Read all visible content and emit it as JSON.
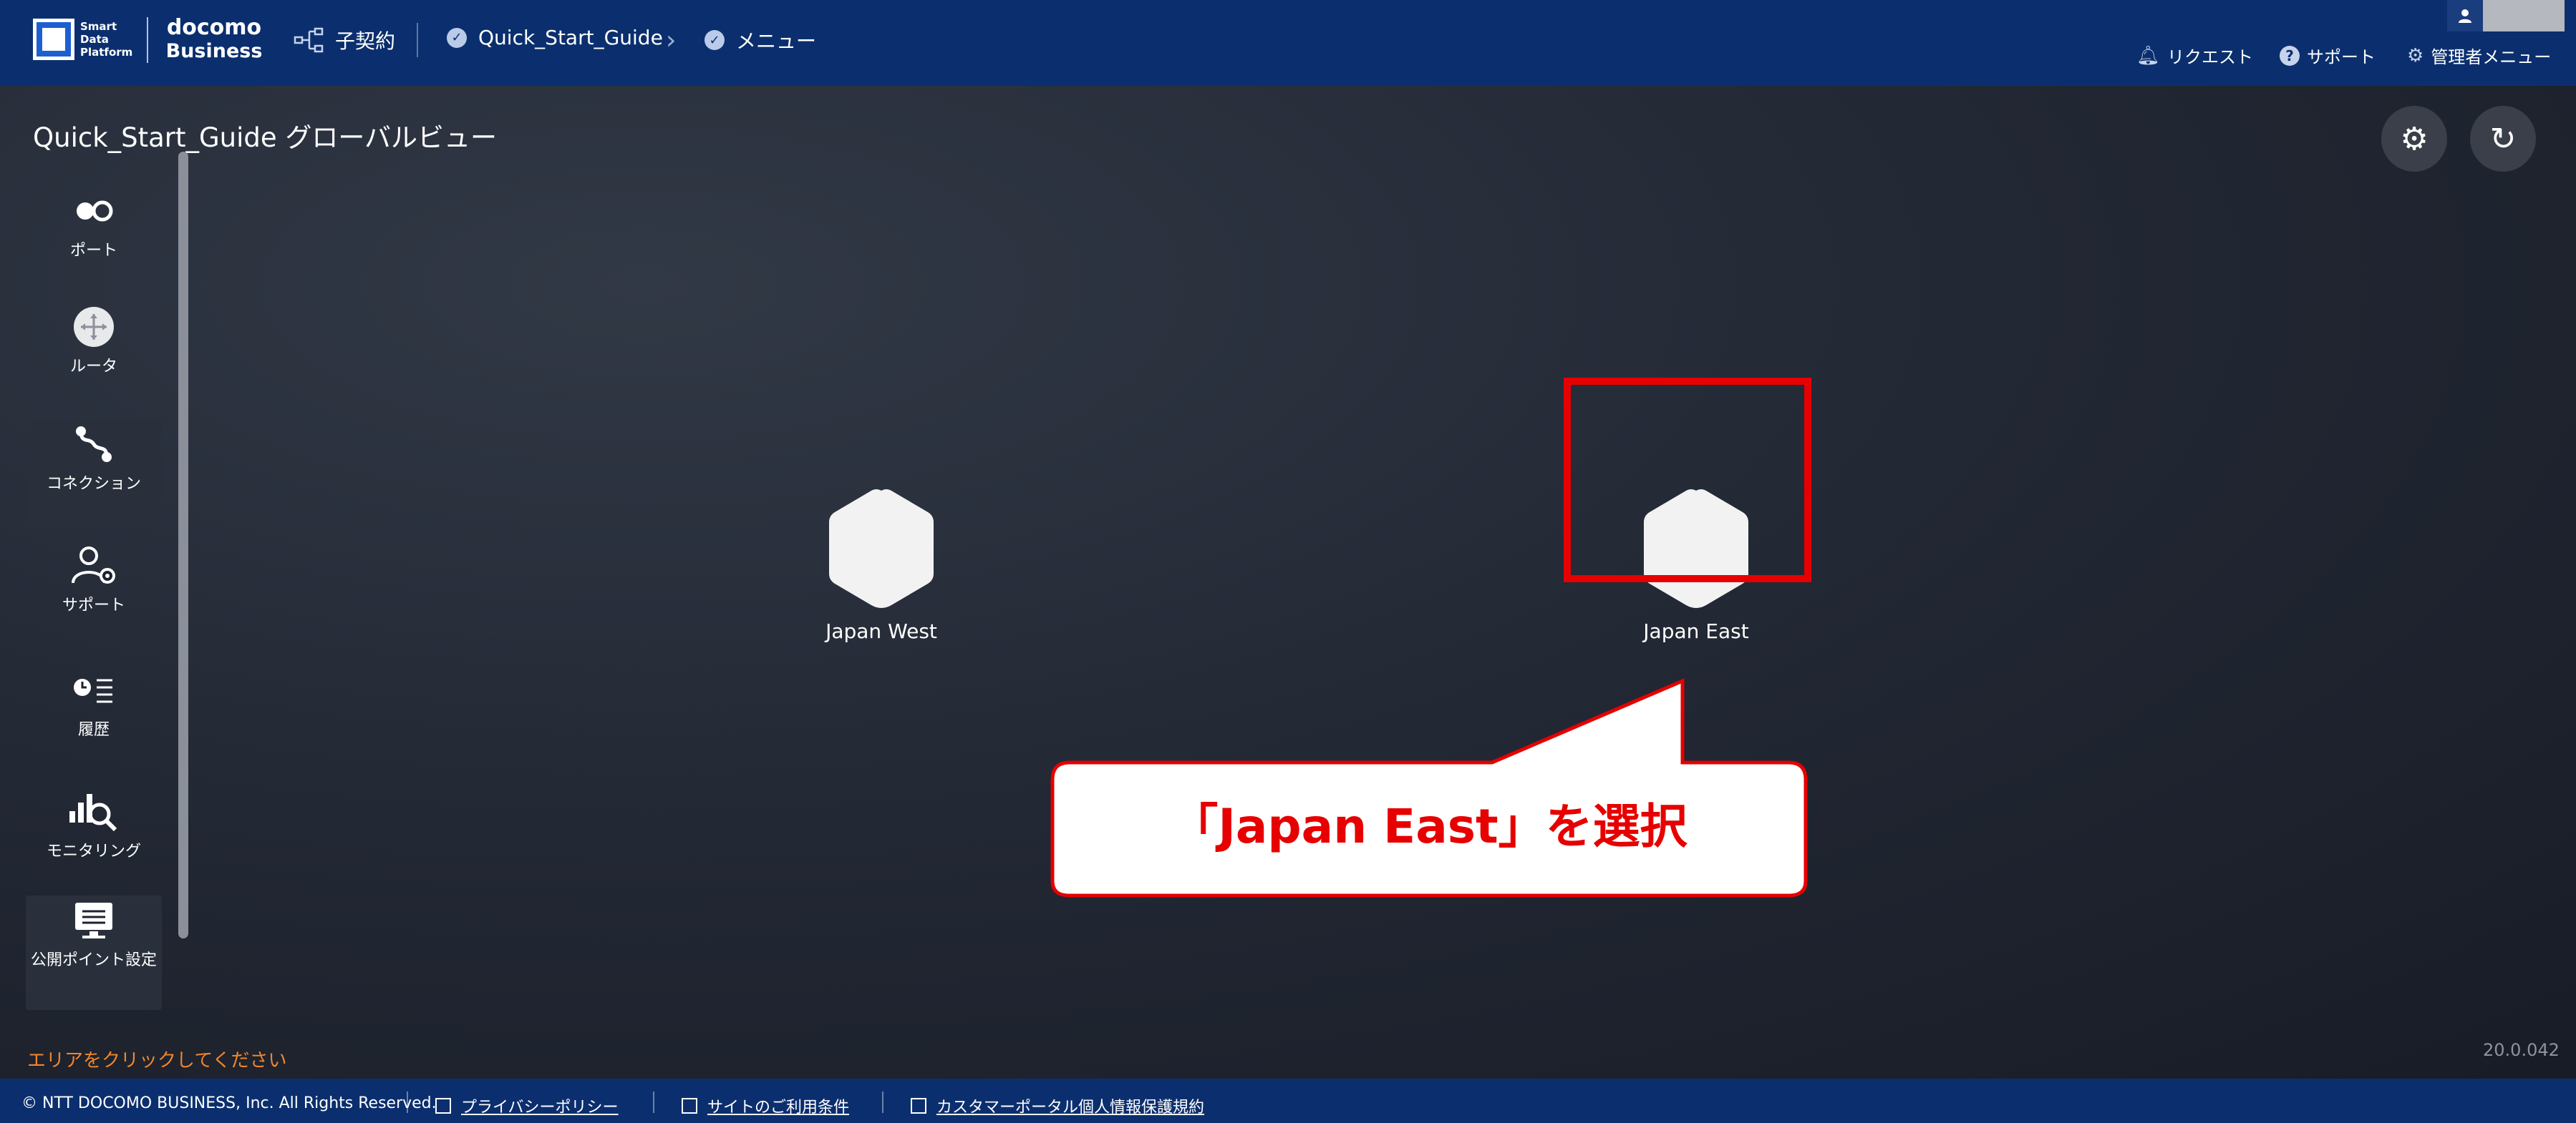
{
  "header": {
    "logo_sdp_line1": "Smart",
    "logo_sdp_line2": "Data",
    "logo_sdp_line3": "Platform",
    "logo_docomo_line1": "docomo",
    "logo_docomo_line2": "Business",
    "breadcrumb": {
      "contract": "子契約",
      "guide": "Quick_Start_Guide",
      "menu": "メニュー"
    },
    "actions": {
      "request": "リクエスト",
      "support": "サポート",
      "admin_menu": "管理者メニュー"
    }
  },
  "main": {
    "title": "Quick_Start_Guide グローバルビュー",
    "hint": "エリアをクリックしてください",
    "version": "20.0.042"
  },
  "sidebar": {
    "items": [
      {
        "label": "ポート",
        "icon": "port-icon"
      },
      {
        "label": "ルータ",
        "icon": "router-icon"
      },
      {
        "label": "コネクション",
        "icon": "connection-icon"
      },
      {
        "label": "サポート",
        "icon": "support-user-icon"
      },
      {
        "label": "履歴",
        "icon": "history-icon"
      },
      {
        "label": "モニタリング",
        "icon": "monitoring-icon"
      },
      {
        "label": "公開ポイント設定",
        "icon": "monitor-icon"
      }
    ]
  },
  "regions": [
    {
      "name": "Japan West"
    },
    {
      "name": "Japan East"
    }
  ],
  "annotation": {
    "callout_text": "「Japan East」を選択",
    "highlight_color": "#e60000"
  },
  "footer": {
    "copyright": "© NTT DOCOMO BUSINESS, Inc. All Rights Reserved.",
    "privacy": "プライバシーポリシー",
    "terms": "サイトのご利用条件",
    "personal_info": "カスタマーポータル個人情報保護規約"
  },
  "colors": {
    "header_bg": "#0b2f6e",
    "hint": "#f0862b"
  }
}
